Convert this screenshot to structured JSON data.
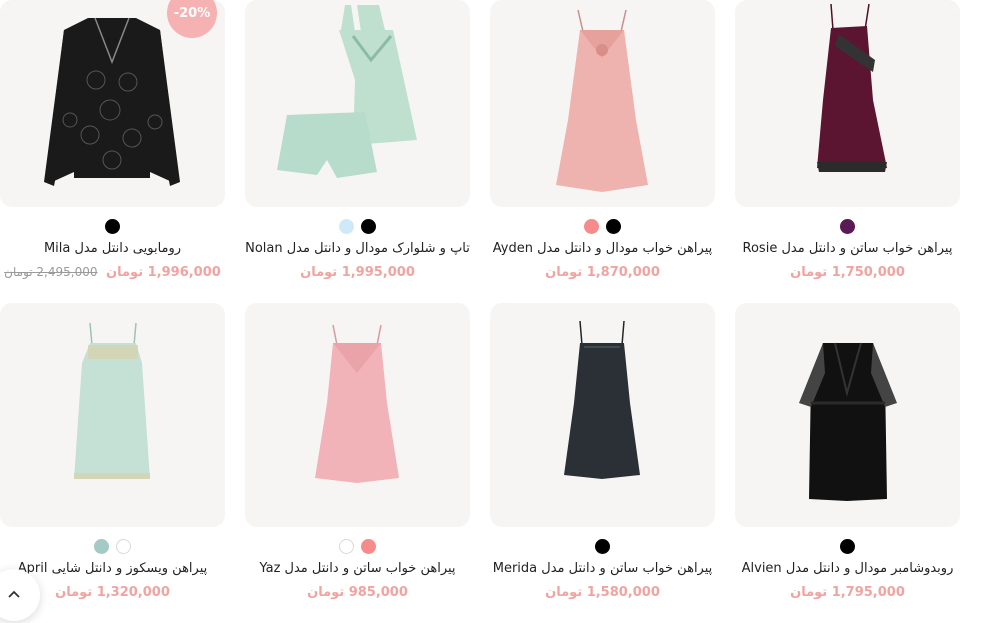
{
  "products": [
    {
      "title": "رومابویی دانتل مدل Mila",
      "price": "1,996,000 تومان",
      "old_price": "2,495,000 تومان",
      "badge": "-20%",
      "swatches": [
        "#000000"
      ],
      "garment_color": "#1a1a1a",
      "icon": "lace-robe-icon"
    },
    {
      "title": "تاپ و شلوارک مودال و دانتل مدل Nolan",
      "price": "1,995,000 تومان",
      "swatches": [
        "#000000",
        "#cfe9f8"
      ],
      "garment_color": "#bfe0cf",
      "icon": "top-shorts-set-icon"
    },
    {
      "title": "پیراهن خواب مودال و دانتل مدل Ayden",
      "price": "1,870,000 تومان",
      "swatches": [
        "#000000",
        "#f58b8b"
      ],
      "garment_color": "#eeb3ae",
      "icon": "nightdress-icon"
    },
    {
      "title": "پیراهن خواب ساتن و دانتل مدل Rosie",
      "price": "1,750,000 تومان",
      "swatches": [
        "#5a1a55"
      ],
      "garment_color": "#5b1530",
      "icon": "satin-slip-icon"
    },
    {
      "title": "پیراهن ویسکوز و دانتل شایی April",
      "price": "1,320,000 تومان",
      "swatches": [
        "#ffffff",
        "#a5c9c7"
      ],
      "garment_color": "#c5e1d6",
      "icon": "slip-dress-icon"
    },
    {
      "title": "پیراهن خواب ساتن و دانتل مدل Yaz",
      "price": "985,000 تومان",
      "swatches": [
        "#f58b8b",
        "#ffffff"
      ],
      "garment_color": "#f2b3b8",
      "icon": "nightdress-icon"
    },
    {
      "title": "پیراهن خواب ساتن و دانتل مدل Merida",
      "price": "1,580,000 تومان",
      "swatches": [
        "#000000"
      ],
      "garment_color": "#2b3036",
      "icon": "satin-slip-icon"
    },
    {
      "title": "روبدوشامبر مودال و دانتل مدل Alvien",
      "price": "1,795,000 تومان",
      "swatches": [
        "#000000"
      ],
      "garment_color": "#111111",
      "icon": "kimono-robe-icon"
    }
  ],
  "scroll_top_icon": "chevron-up-icon"
}
